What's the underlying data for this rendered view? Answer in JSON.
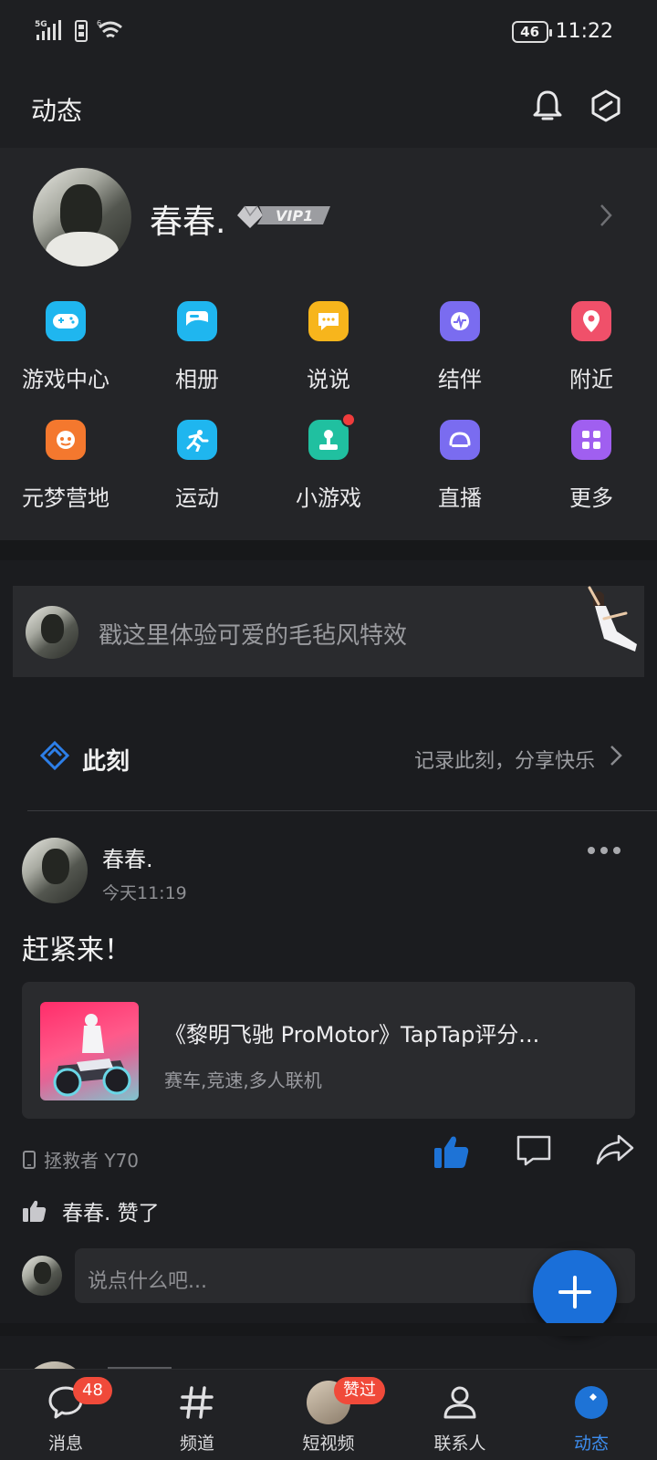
{
  "status_bar": {
    "network": "5G",
    "wifi_label": "6",
    "battery": "46",
    "time": "11:22"
  },
  "header": {
    "title": "动态"
  },
  "profile": {
    "name": "春春.",
    "vip": "VIP1"
  },
  "grid": [
    {
      "label": "游戏中心",
      "icon": "gamepad-icon",
      "color": "#1fb6ef"
    },
    {
      "label": "相册",
      "icon": "album-icon",
      "color": "#1fb6ef"
    },
    {
      "label": "说说",
      "icon": "chat-bubble-icon",
      "color": "#f7b51c"
    },
    {
      "label": "结伴",
      "icon": "partner-icon",
      "color": "#7a6cf0"
    },
    {
      "label": "附近",
      "icon": "location-pin-icon",
      "color": "#f0506a"
    },
    {
      "label": "元梦营地",
      "icon": "camp-icon",
      "color": "#f4782e"
    },
    {
      "label": "运动",
      "icon": "running-icon",
      "color": "#1fb6ef"
    },
    {
      "label": "小游戏",
      "icon": "joystick-icon",
      "color": "#20c0a0"
    },
    {
      "label": "直播",
      "icon": "live-icon",
      "color": "#7a6cf0"
    },
    {
      "label": "更多",
      "icon": "more-grid-icon",
      "color": "#a05ff0"
    }
  ],
  "promo": {
    "text": "戳这里体验可爱的毛毡风特效"
  },
  "moment": {
    "title": "此刻",
    "subtitle": "记录此刻，分享快乐"
  },
  "post": {
    "author": "春春.",
    "time": "今天11:19",
    "text": "赶紧来！",
    "share": {
      "title": "《黎明飞驰 ProMotor》TapTap评分...",
      "tags": "赛车,竞速,多人联机"
    },
    "device": "拯救者 Y70",
    "likes": "春春. 赞了",
    "comment_placeholder": "说点什么吧..."
  },
  "bottom_nav": [
    {
      "label": "消息",
      "icon": "message-icon",
      "badge": "48"
    },
    {
      "label": "频道",
      "icon": "hashtag-icon"
    },
    {
      "label": "短视频",
      "icon": "short-video-icon",
      "badge": "赞过"
    },
    {
      "label": "联系人",
      "icon": "contacts-icon"
    },
    {
      "label": "动态",
      "icon": "moments-star-icon",
      "active": true
    }
  ],
  "colors": {
    "accent": "#1a6fd9",
    "badge": "#f04a3a",
    "background": "#1b1c1f"
  }
}
